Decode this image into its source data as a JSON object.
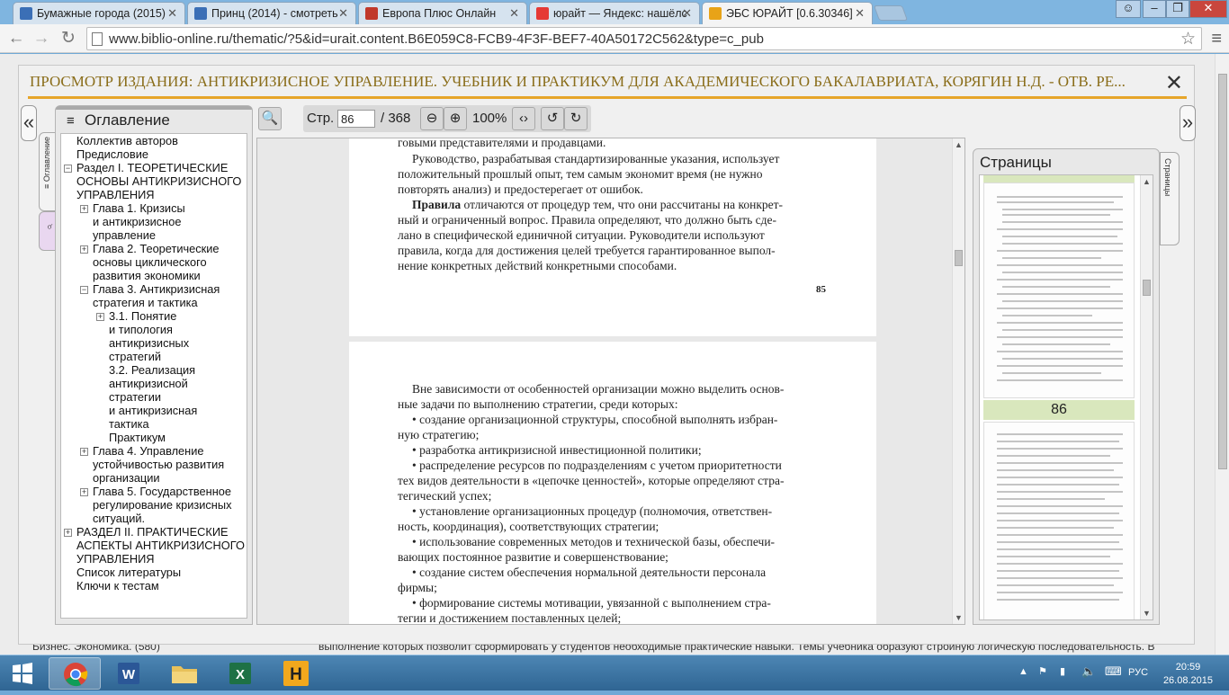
{
  "browser": {
    "tabs": [
      {
        "title": "Бумажные города (2015)",
        "icon": "film-icon",
        "color": "#3b6fb6"
      },
      {
        "title": "Принц (2014) - смотреть",
        "icon": "film-icon",
        "color": "#3b6fb6"
      },
      {
        "title": "Европа Плюс Онлайн",
        "icon": "radio-icon",
        "color": "#c0392b"
      },
      {
        "title": "юрайт — Яндекс: нашёлс",
        "icon": "yandex-icon",
        "color": "#e53935"
      },
      {
        "title": "ЭБС ЮРАЙТ [0.6.30346]",
        "icon": "urait-icon",
        "color": "#e8a317"
      }
    ],
    "url": "www.biblio-online.ru/thematic/?5&id=urait.content.B6E059C8-FCB9-4F3F-BEF7-40A50172C562&type=c_pub"
  },
  "modal": {
    "title": "ПРОСМОТР ИЗДАНИЯ: АНТИКРИЗИСНОЕ УПРАВЛЕНИЕ. УЧЕБНИК И ПРАКТИКУМ ДЛЯ АКАДЕМИЧЕСКОГО БАКАЛАВРИАТА, КОРЯГИН Н.Д. - ОТВ. РЕ...",
    "close": "✕",
    "accent_color": "#e6a52a"
  },
  "toc": {
    "heading": "Оглавление",
    "tab_label": "≡ Оглавление",
    "items": [
      {
        "label": "Коллектив авторов"
      },
      {
        "label": "Предисловие"
      },
      {
        "label": "Раздел I. ТЕОРЕТИЧЕСКИЕ",
        "l2": "ОСНОВЫ АНТИКРИЗИСНОГО",
        "l3": "УПРАВЛЕНИЯ"
      },
      {
        "label": "Глава 1. Кризисы",
        "l2": "и антикризисное",
        "l3": "управление"
      },
      {
        "label": "Глава 2. Теоретические",
        "l2": "основы циклического",
        "l3": "развития экономики"
      },
      {
        "label": "Глава 3. Антикризисная",
        "l2": "стратегия и тактика"
      },
      {
        "label": "3.1. Понятие",
        "l2": "и типология",
        "l3": "антикризисных",
        "l4": "стратегий"
      },
      {
        "label": "3.2. Реализация",
        "l2": "антикризисной",
        "l3": "стратегии"
      },
      {
        "label": "и антикризисная",
        "l2": "тактика"
      },
      {
        "label": "Практикум"
      },
      {
        "label": "Глава 4. Управление",
        "l2": "устойчивостью развития",
        "l3": "организации"
      },
      {
        "label": "Глава 5. Государственное",
        "l2": "регулирование кризисных",
        "l3": "ситуаций."
      },
      {
        "label": "РАЗДЕЛ II. ПРАКТИЧЕСКИЕ",
        "l2": "АСПЕКТЫ АНТИКРИЗИСНОГО",
        "l3": "УПРАВЛЕНИЯ"
      },
      {
        "label": "Список литературы"
      },
      {
        "label": "Ключи к тестам"
      }
    ]
  },
  "viewer": {
    "page_label": "Стр.",
    "page_value": "86",
    "total": "/ 368",
    "zoom": "100%",
    "page_top": {
      "lines": [
        "говыми представителями и продавцами.",
        "Руководство, разрабатывая стандартизированные указания, использует",
        "положительный прошлый опыт, тем самым экономит время (не нужно",
        "повторять анализ) и предостерегает от ошибок.",
        "Правила",
        " отличаются от процедур тем, что они рассчитаны на конкрет-",
        "ный и ограниченный вопрос. Правила определяют, что должно быть сде-",
        "лано в специфической единичной ситуации. Руководители используют",
        "правила, когда для достижения целей требуется гарантированное выпол-",
        "нение конкретных действий конкретными способами."
      ],
      "number": "85"
    },
    "page_bottom": {
      "lines": [
        "Вне зависимости от особенностей организации можно выделить основ-",
        "ные задачи по выполнению стратегии, среди которых:",
        "•   создание организационной структуры, способной выполнять избран-",
        "ную стратегию;",
        "•   разработка антикризисной инвестиционной политики;",
        "•   распределение ресурсов по подразделениям с учетом приоритетности",
        "тех видов деятельности в «цепочке ценностей», которые определяют стра-",
        "тегический успех;",
        "•   установление организационных процедур (полномочия, ответствен-",
        "ность, координация), соответствующих стратегии;",
        "•   использование современных методов и технической базы, обеспечи-",
        "вающих постоянное развитие и совершенствование;",
        "•   создание систем обеспечения нормальной деятельности персонала",
        "фирмы;",
        "•   формирование системы мотивации, увязанной с выполнением стра-",
        "тегии и достижением поставленных целей;"
      ]
    }
  },
  "pages_panel": {
    "heading": "Страницы",
    "tab_label": "Страницы",
    "current": "86"
  },
  "background": {
    "left_text": "Бизнес. Экономика. (580)",
    "right_text": "выполнение которых позволит сформировать у студентов необходимые практические навыки. Темы учебника образуют стройную логическую последовательность. В"
  },
  "taskbar": {
    "lang": "РУС",
    "time": "20:59",
    "date": "26.08.2015"
  }
}
